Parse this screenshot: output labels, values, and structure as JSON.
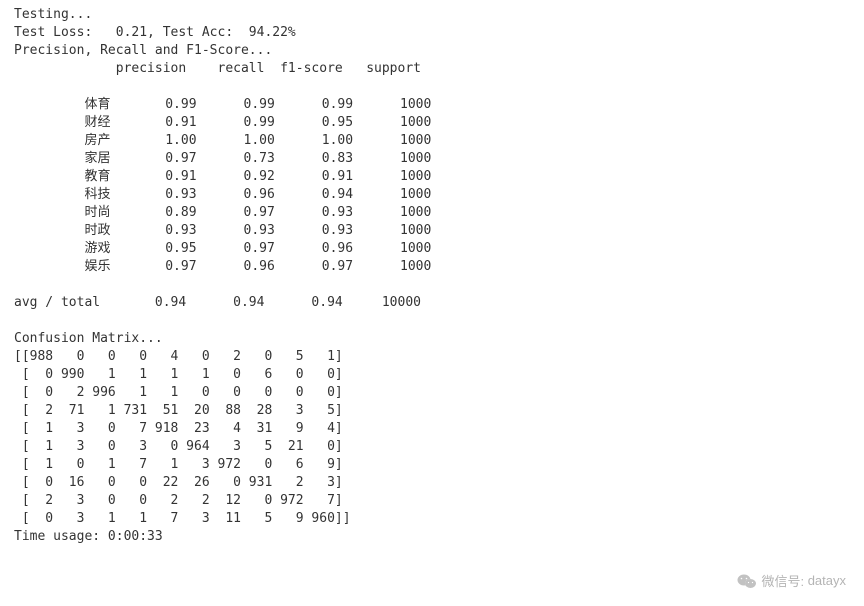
{
  "lines": {
    "testing": "Testing...",
    "test_loss": "Test Loss:   0.21, Test Acc:  94.22%",
    "pr_header": "Precision, Recall and F1-Score...",
    "avg_total": "avg / total",
    "confusion_header": "Confusion Matrix...",
    "time_usage": "Time usage: 0:00:33"
  },
  "metrics": {
    "test_loss": 0.21,
    "test_acc_pct": 94.22
  },
  "report": {
    "columns": [
      "precision",
      "recall",
      "f1-score",
      "support"
    ],
    "rows": [
      {
        "label": "体育",
        "precision": "0.99",
        "recall": "0.99",
        "f1": "0.99",
        "support": "1000"
      },
      {
        "label": "财经",
        "precision": "0.91",
        "recall": "0.99",
        "f1": "0.95",
        "support": "1000"
      },
      {
        "label": "房产",
        "precision": "1.00",
        "recall": "1.00",
        "f1": "1.00",
        "support": "1000"
      },
      {
        "label": "家居",
        "precision": "0.97",
        "recall": "0.73",
        "f1": "0.83",
        "support": "1000"
      },
      {
        "label": "教育",
        "precision": "0.91",
        "recall": "0.92",
        "f1": "0.91",
        "support": "1000"
      },
      {
        "label": "科技",
        "precision": "0.93",
        "recall": "0.96",
        "f1": "0.94",
        "support": "1000"
      },
      {
        "label": "时尚",
        "precision": "0.89",
        "recall": "0.97",
        "f1": "0.93",
        "support": "1000"
      },
      {
        "label": "时政",
        "precision": "0.93",
        "recall": "0.93",
        "f1": "0.93",
        "support": "1000"
      },
      {
        "label": "游戏",
        "precision": "0.95",
        "recall": "0.97",
        "f1": "0.96",
        "support": "1000"
      },
      {
        "label": "娱乐",
        "precision": "0.97",
        "recall": "0.96",
        "f1": "0.97",
        "support": "1000"
      }
    ],
    "avg": {
      "precision": "0.94",
      "recall": "0.94",
      "f1": "0.94",
      "support": "10000"
    }
  },
  "confusion_matrix": [
    [
      988,
      0,
      0,
      0,
      4,
      0,
      2,
      0,
      5,
      1
    ],
    [
      0,
      990,
      1,
      1,
      1,
      1,
      0,
      6,
      0,
      0
    ],
    [
      0,
      2,
      996,
      1,
      1,
      0,
      0,
      0,
      0,
      0
    ],
    [
      2,
      71,
      1,
      731,
      51,
      20,
      88,
      28,
      3,
      5
    ],
    [
      1,
      3,
      0,
      7,
      918,
      23,
      4,
      31,
      9,
      4
    ],
    [
      1,
      3,
      0,
      3,
      0,
      964,
      3,
      5,
      21,
      0
    ],
    [
      1,
      0,
      1,
      7,
      1,
      3,
      972,
      0,
      6,
      9
    ],
    [
      0,
      16,
      0,
      0,
      22,
      26,
      0,
      931,
      2,
      3
    ],
    [
      2,
      3,
      0,
      0,
      2,
      2,
      12,
      0,
      972,
      7
    ],
    [
      0,
      3,
      1,
      1,
      7,
      3,
      11,
      5,
      9,
      960
    ]
  ],
  "time_usage": "0:00:33",
  "watermark": {
    "label": "微信号:",
    "id": "datayx"
  }
}
